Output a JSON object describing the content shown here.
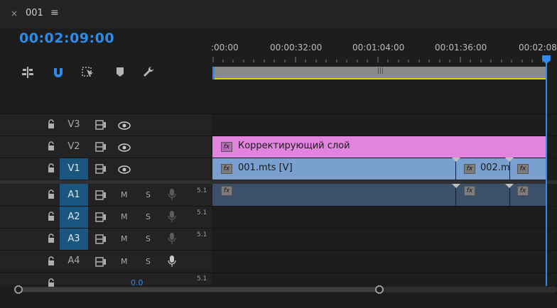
{
  "window": {
    "close_glyph": "×",
    "tab_name": "001",
    "menu_glyph": "≡"
  },
  "timecode": "00:02:09:00",
  "tools": [
    {
      "name": "insert-and-overwrite-sequences-icon"
    },
    {
      "name": "snap-magnet-icon",
      "active": true
    },
    {
      "name": "linked-selection-icon"
    },
    {
      "name": "add-marker-icon"
    },
    {
      "name": "timeline-settings-wrench-icon"
    }
  ],
  "ruler": {
    "labels": [
      ":00:00",
      "00:00:32:00",
      "00:01:04:00",
      "00:01:36:00",
      "00:02:08"
    ]
  },
  "video_tracks": [
    {
      "name": "V3",
      "active": false
    },
    {
      "name": "V2",
      "active": false
    },
    {
      "name": "V1",
      "active": true
    }
  ],
  "audio_tracks": [
    {
      "name": "A1",
      "active": true,
      "channels": "5.1",
      "mute": "M",
      "solo": "S"
    },
    {
      "name": "A2",
      "active": true,
      "channels": "5.1",
      "mute": "M",
      "solo": "S"
    },
    {
      "name": "A3",
      "active": true,
      "channels": "5.1",
      "mute": "M",
      "solo": "S"
    },
    {
      "name": "A4",
      "active": false,
      "channels": "",
      "mute": "M",
      "solo": "S"
    }
  ],
  "master": {
    "channels": "5.1",
    "value": "0.0"
  },
  "clips": {
    "v2": {
      "label": "Корректирующий слой",
      "color": "#e283e0"
    },
    "v1": [
      {
        "label": "001.mts [V]"
      },
      {
        "label": "002.m"
      },
      {
        "label": ""
      }
    ],
    "fx": "fx"
  },
  "colors": {
    "accent": "#2d8ceb",
    "video_clip": "#7aa0d0",
    "audio_clip": "#3c506a",
    "work_area": "#e0d300"
  }
}
